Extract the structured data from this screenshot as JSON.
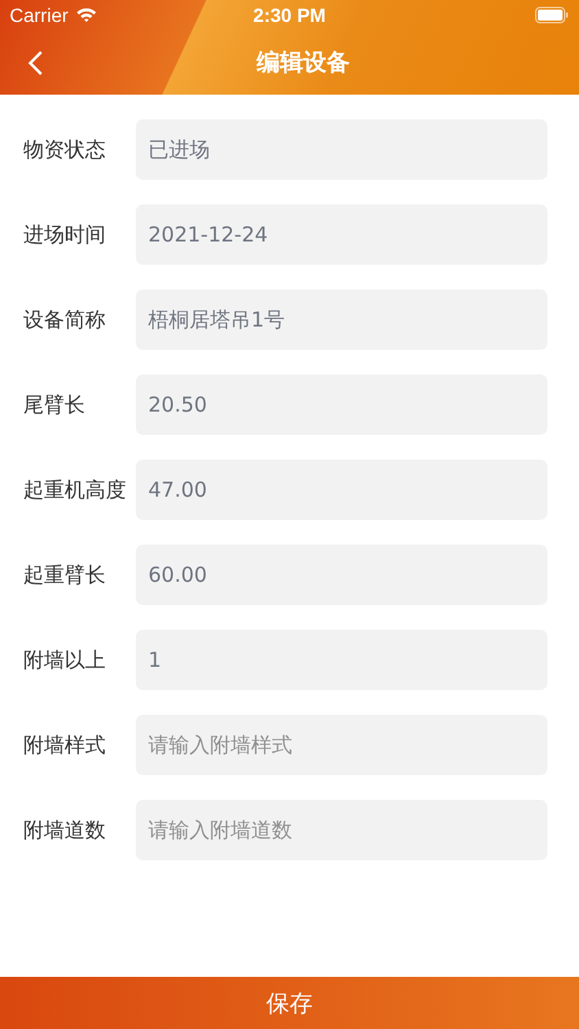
{
  "status_bar": {
    "carrier": "Carrier",
    "time": "2:30 PM"
  },
  "nav": {
    "title": "编辑设备"
  },
  "fields": [
    {
      "label": "物资状态",
      "value": "已进场"
    },
    {
      "label": "进场时间",
      "value": "2021-12-24"
    },
    {
      "label": "设备简称",
      "value": "梧桐居塔吊1号"
    },
    {
      "label": "尾臂长",
      "value": "20.50"
    },
    {
      "label": "起重机高度",
      "value": "47.00"
    },
    {
      "label": "起重臂长",
      "value": "60.00"
    },
    {
      "label": "附墙以上",
      "value": "1"
    },
    {
      "label": "附墙样式",
      "placeholder": "请输入附墙样式"
    },
    {
      "label": "附墙道数",
      "placeholder": "请输入附墙道数"
    }
  ],
  "save_button": "保存"
}
